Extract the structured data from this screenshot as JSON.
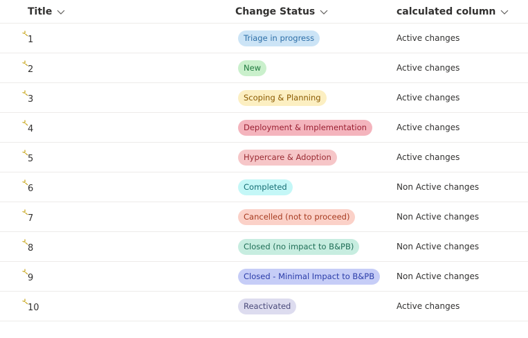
{
  "header": {
    "title_label": "Title",
    "status_label": "Change Status",
    "calc_label": "calculated column"
  },
  "colors": {
    "new_item_icon": "#c19c00"
  },
  "rows": [
    {
      "title": "1",
      "status": "Triage in progress",
      "calc": "Active changes",
      "pill_bg": "#cce4f6",
      "pill_fg": "#2d6fa8"
    },
    {
      "title": "2",
      "status": "New",
      "calc": "Active changes",
      "pill_bg": "#caf0cc",
      "pill_fg": "#1f7a3e"
    },
    {
      "title": "3",
      "status": "Scoping & Planning",
      "calc": "Active changes",
      "pill_bg": "#fcefc2",
      "pill_fg": "#8a5a00"
    },
    {
      "title": "4",
      "status": "Deployment & Implementation",
      "calc": "Active changes",
      "pill_bg": "#f4b4bd",
      "pill_fg": "#9a1f32"
    },
    {
      "title": "5",
      "status": "Hypercare & Adoption",
      "calc": "Active changes",
      "pill_bg": "#f6c6c8",
      "pill_fg": "#9a2b33"
    },
    {
      "title": "6",
      "status": "Completed",
      "calc": "Non Active changes",
      "pill_bg": "#c4f7f7",
      "pill_fg": "#166e74"
    },
    {
      "title": "7",
      "status": "Cancelled (not to proceed)",
      "calc": "Non Active changes",
      "pill_bg": "#fbd1c8",
      "pill_fg": "#a63a1f"
    },
    {
      "title": "8",
      "status": "Closed (no impact to B&PB)",
      "calc": "Non Active changes",
      "pill_bg": "#c7ede0",
      "pill_fg": "#1f6e56"
    },
    {
      "title": "9",
      "status": "Closed - Minimal Impact to B&PB",
      "calc": "Non Active changes",
      "pill_bg": "#c6cdf7",
      "pill_fg": "#2a3ca8"
    },
    {
      "title": "10",
      "status": "Reactivated",
      "calc": "Active changes",
      "pill_bg": "#dddcef",
      "pill_fg": "#4a4a7a"
    }
  ]
}
